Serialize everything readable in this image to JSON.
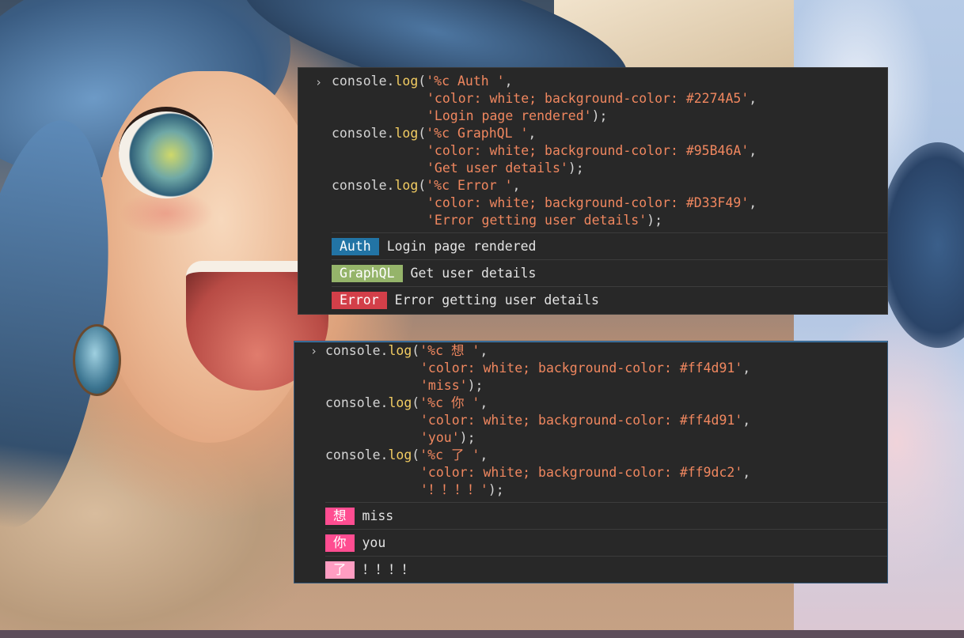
{
  "console_top": {
    "entries": [
      {
        "code": {
          "fn_obj": "console.",
          "fn_name": "log",
          "arg1": "'%c Auth '",
          "arg2": "'color: white; background-color: #2274A5'",
          "arg3": "'Login page rendered'"
        },
        "output": {
          "badge": "Auth",
          "badge_color": "#2274A5",
          "message": "Login page rendered"
        }
      },
      {
        "code": {
          "fn_obj": "console.",
          "fn_name": "log",
          "arg1": "'%c GraphQL '",
          "arg2": "'color: white; background-color: #95B46A'",
          "arg3": "'Get user details'"
        },
        "output": {
          "badge": "GraphQL",
          "badge_color": "#95B46A",
          "message": "Get user details"
        }
      },
      {
        "code": {
          "fn_obj": "console.",
          "fn_name": "log",
          "arg1": "'%c Error '",
          "arg2": "'color: white; background-color: #D33F49'",
          "arg3": "'Error getting user details'"
        },
        "output": {
          "badge": "Error",
          "badge_color": "#D33F49",
          "message": "Error getting user details"
        }
      }
    ]
  },
  "console_bottom": {
    "entries": [
      {
        "code": {
          "fn_obj": "console.",
          "fn_name": "log",
          "arg1": "'%c 想 '",
          "arg2": "'color: white; background-color: #ff4d91'",
          "arg3": "'miss'"
        },
        "output": {
          "badge": "想",
          "badge_color": "#ff4d91",
          "message": "miss"
        }
      },
      {
        "code": {
          "fn_obj": "console.",
          "fn_name": "log",
          "arg1": "'%c 你 '",
          "arg2": "'color: white; background-color: #ff4d91'",
          "arg3": "'you'"
        },
        "output": {
          "badge": "你",
          "badge_color": "#ff4d91",
          "message": "you"
        }
      },
      {
        "code": {
          "fn_obj": "console.",
          "fn_name": "log",
          "arg1": "'%c 了 '",
          "arg2": "'color: white; background-color: #ff9dc2'",
          "arg3": "'！！！！'"
        },
        "output": {
          "badge": "了",
          "badge_color": "#ff9dc2",
          "message": "！！！！"
        }
      }
    ]
  },
  "prompt_icon": "chevron-right-icon",
  "prompt_glyph": "›",
  "syntax": {
    "fn_color": "#f2cc62",
    "string_color": "#f0875f",
    "text_color": "#d4d4d4"
  }
}
